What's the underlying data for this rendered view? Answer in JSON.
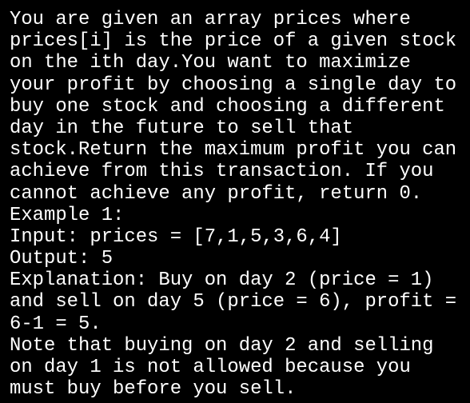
{
  "colors": {
    "background": "#000000",
    "text": "#ffffff"
  },
  "terminal": {
    "lines": [
      "You are given an array prices where",
      "prices[i] is the price of a given stock",
      "on the ith day.You want to maximize",
      "your profit by choosing a single day to",
      "buy one stock and choosing a different",
      "day in the future to sell that",
      "stock.Return the maximum profit you can",
      "achieve from this transaction. If you",
      "cannot achieve any profit, return 0.",
      "Example 1:",
      "Input: prices = [7,1,5,3,6,4]",
      "Output: 5",
      "Explanation: Buy on day 2 (price = 1)",
      "and sell on day 5 (price = 6), profit =",
      "6-1 = 5.",
      "Note that buying on day 2 and selling",
      "on day 1 is not allowed because you",
      "must buy before you sell."
    ]
  }
}
